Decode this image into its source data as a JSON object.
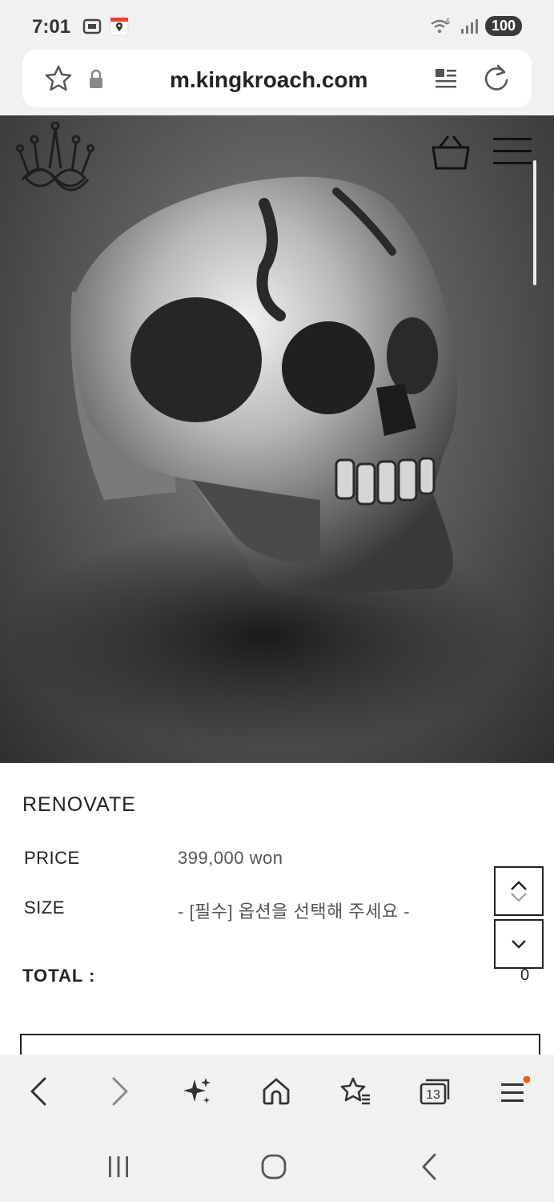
{
  "status_bar": {
    "time": "7:01",
    "battery": "100",
    "network": "5"
  },
  "browser": {
    "url": "m.kingkroach.com",
    "tab_count": "13"
  },
  "site": {
    "logo_icon": "crown-logo-icon",
    "cart_icon": "shopping-bag-icon",
    "menu_icon": "hamburger-icon"
  },
  "product": {
    "name": "RENOVATE",
    "price_label": "PRICE",
    "price_value": "399,000 won",
    "size_label": "SIZE",
    "size_value": "- [필수] 옵션을 선택해 주세요 -",
    "total_label": "TOTAL :",
    "total_value": "0"
  },
  "colors": {
    "toolbar_bg": "#f1f1f1",
    "notification_dot": "#e8620f"
  }
}
